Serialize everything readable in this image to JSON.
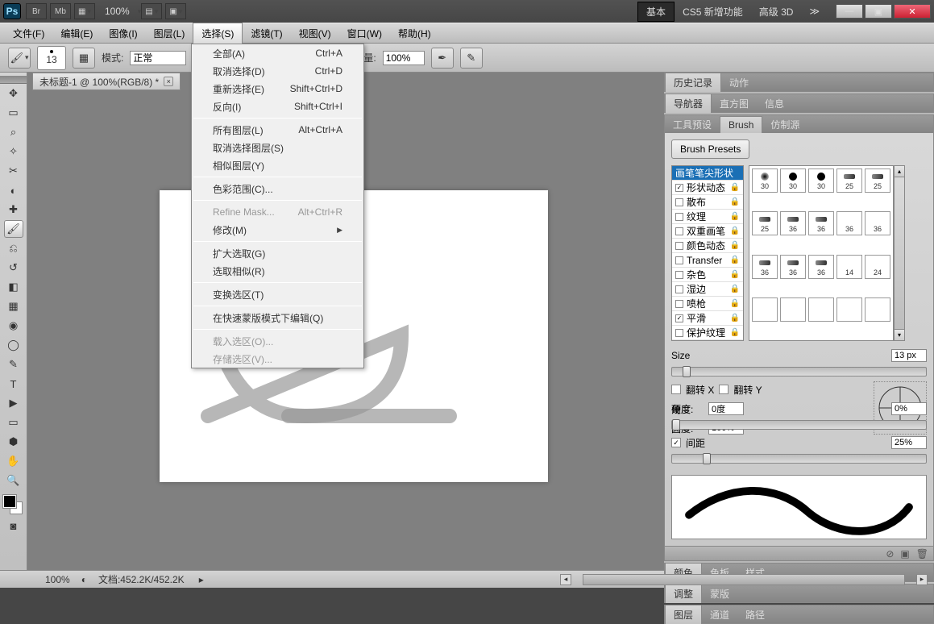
{
  "appbar": {
    "zoom": "100%",
    "ws_basic": "基本",
    "ws_cs5": "CS5 新增功能",
    "ws_3d": "高级 3D"
  },
  "menubar": {
    "items": [
      "文件(F)",
      "编辑(E)",
      "图像(I)",
      "图层(L)",
      "选择(S)",
      "滤镜(T)",
      "视图(V)",
      "窗口(W)",
      "帮助(H)"
    ],
    "open_index": 4
  },
  "dropdown": {
    "groups": [
      [
        {
          "label": "全部(A)",
          "shortcut": "Ctrl+A",
          "disabled": false
        },
        {
          "label": "取消选择(D)",
          "shortcut": "Ctrl+D",
          "disabled": false
        },
        {
          "label": "重新选择(E)",
          "shortcut": "Shift+Ctrl+D",
          "disabled": false
        },
        {
          "label": "反向(I)",
          "shortcut": "Shift+Ctrl+I",
          "disabled": false
        }
      ],
      [
        {
          "label": "所有图层(L)",
          "shortcut": "Alt+Ctrl+A",
          "disabled": false
        },
        {
          "label": "取消选择图层(S)",
          "shortcut": "",
          "disabled": false
        },
        {
          "label": "相似图层(Y)",
          "shortcut": "",
          "disabled": false
        }
      ],
      [
        {
          "label": "色彩范围(C)...",
          "shortcut": "",
          "disabled": false
        }
      ],
      [
        {
          "label": "Refine Mask...",
          "shortcut": "Alt+Ctrl+R",
          "disabled": true
        },
        {
          "label": "修改(M)",
          "shortcut": "",
          "disabled": false,
          "submenu": true
        }
      ],
      [
        {
          "label": "扩大选取(G)",
          "shortcut": "",
          "disabled": false
        },
        {
          "label": "选取相似(R)",
          "shortcut": "",
          "disabled": false
        }
      ],
      [
        {
          "label": "变换选区(T)",
          "shortcut": "",
          "disabled": false
        }
      ],
      [
        {
          "label": "在快速蒙版模式下编辑(Q)",
          "shortcut": "",
          "disabled": false
        }
      ],
      [
        {
          "label": "载入选区(O)...",
          "shortcut": "",
          "disabled": true
        },
        {
          "label": "存储选区(V)...",
          "shortcut": "",
          "disabled": true
        }
      ]
    ]
  },
  "optbar": {
    "brush_size_num": "13",
    "mode_label": "模式:",
    "mode_value": "正常",
    "flow_label": "流量:",
    "flow_value": "100%"
  },
  "tab": {
    "title": "未标题-1 @ 100%(RGB/8) *"
  },
  "panels": {
    "p0": {
      "tabs": [
        "历史记录",
        "动作"
      ],
      "active": 0
    },
    "p1": {
      "tabs": [
        "导航器",
        "直方图",
        "信息"
      ],
      "active": 0
    },
    "p2": {
      "tabs": [
        "工具预设",
        "Brush",
        "仿制源"
      ],
      "active": 1,
      "brush_presets_btn": "Brush Presets",
      "shape_items": [
        {
          "label": "画笔笔尖形状",
          "checked": null,
          "sel": true,
          "lock": false
        },
        {
          "label": "形状动态",
          "checked": true,
          "lock": true
        },
        {
          "label": "散布",
          "checked": false,
          "lock": true
        },
        {
          "label": "纹理",
          "checked": false,
          "lock": true
        },
        {
          "label": "双重画笔",
          "checked": false,
          "lock": true
        },
        {
          "label": "颜色动态",
          "checked": false,
          "lock": true
        },
        {
          "label": "Transfer",
          "checked": false,
          "lock": true
        },
        {
          "label": "杂色",
          "checked": false,
          "lock": true
        },
        {
          "label": "湿边",
          "checked": false,
          "lock": true
        },
        {
          "label": "喷枪",
          "checked": false,
          "lock": true
        },
        {
          "label": "平滑",
          "checked": true,
          "lock": true
        },
        {
          "label": "保护纹理",
          "checked": false,
          "lock": true
        }
      ],
      "thumbs": [
        {
          "s": "30",
          "k": "soft"
        },
        {
          "s": "30",
          "k": "hard"
        },
        {
          "s": "30",
          "k": "hard"
        },
        {
          "s": "25",
          "k": "flat"
        },
        {
          "s": "25",
          "k": "flat"
        },
        {
          "s": "25",
          "k": "flat"
        },
        {
          "s": "36",
          "k": "flat"
        },
        {
          "s": "36",
          "k": "flat"
        },
        {
          "s": "36",
          "k": "spray"
        },
        {
          "s": "36",
          "k": "spray"
        },
        {
          "s": "36",
          "k": "flat"
        },
        {
          "s": "36",
          "k": "flat"
        },
        {
          "s": "36",
          "k": "flat"
        },
        {
          "s": "14",
          "k": "spray"
        },
        {
          "s": "24",
          "k": "spray"
        },
        {
          "s": "",
          "k": "spray"
        },
        {
          "s": "",
          "k": "spray"
        },
        {
          "s": "",
          "k": "spray"
        },
        {
          "s": "",
          "k": "spray"
        },
        {
          "s": "",
          "k": "spray"
        }
      ],
      "size_label": "Size",
      "size_value": "13 px",
      "flip_x": "翻转 X",
      "flip_y": "翻转 Y",
      "angle_label": "角度:",
      "angle_value": "0度",
      "round_label": "圆度:",
      "round_value": "100%",
      "hardness_label": "硬度",
      "hardness_value": "0%",
      "spacing_label": "间距",
      "spacing_value": "25%"
    },
    "p3": {
      "tabs": [
        "颜色",
        "色板",
        "样式"
      ],
      "active": 0
    },
    "p4": {
      "tabs": [
        "调整",
        "蒙版"
      ],
      "active": 0
    },
    "p5": {
      "tabs": [
        "图层",
        "通道",
        "路径"
      ],
      "active": 0
    }
  },
  "status": {
    "zoom": "100%",
    "doc": "文档:452.2K/452.2K"
  }
}
